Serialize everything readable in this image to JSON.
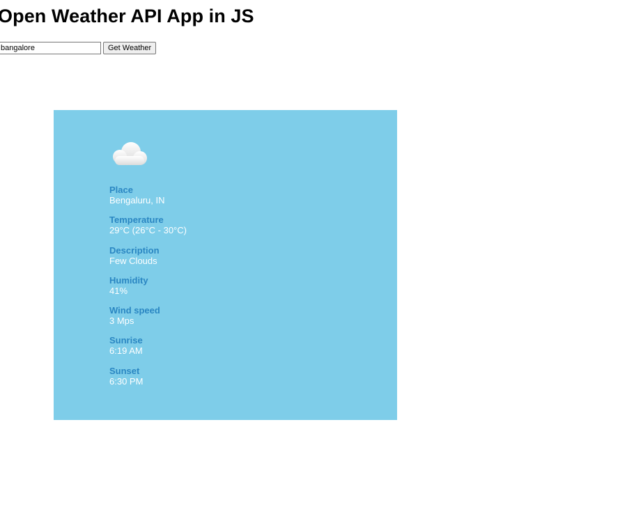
{
  "page": {
    "title": "Open Weather API App in JS"
  },
  "search": {
    "value": "bangalore",
    "button_label": "Get Weather"
  },
  "weather": {
    "icon": "cloud-icon",
    "fields": [
      {
        "label": "Place",
        "value": "Bengaluru, IN"
      },
      {
        "label": "Temperature",
        "value": "29°C (26°C - 30°C)"
      },
      {
        "label": "Description",
        "value": "Few Clouds"
      },
      {
        "label": "Humidity",
        "value": "41%"
      },
      {
        "label": "Wind speed",
        "value": "3 Mps"
      },
      {
        "label": "Sunrise",
        "value": "6:19 AM"
      },
      {
        "label": "Sunset",
        "value": "6:30 PM"
      }
    ]
  },
  "colors": {
    "card_background": "#7ecde9",
    "label": "#2a86c2",
    "value": "#ffffff"
  }
}
